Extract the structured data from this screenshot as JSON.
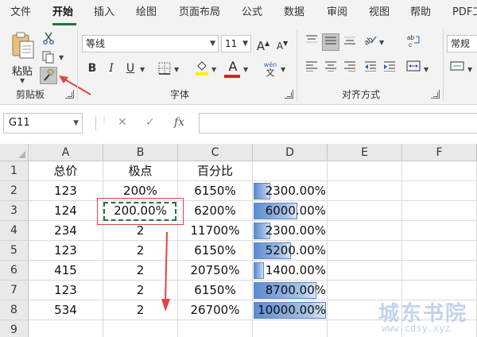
{
  "ribbon_tabs": [
    "文件",
    "开始",
    "插入",
    "绘图",
    "页面布局",
    "公式",
    "数据",
    "审阅",
    "视图",
    "帮助",
    "PDF工"
  ],
  "active_tab": "开始",
  "clipboard": {
    "paste_label": "粘贴",
    "group_label": "剪贴板"
  },
  "font": {
    "name": "等线",
    "size": "11",
    "group_label": "字体",
    "bold": "B",
    "italic": "I",
    "underline": "U",
    "increase": "A",
    "decrease": "A",
    "font_color_letter": "A",
    "phonetic": "wén",
    "phonetic_char": "文"
  },
  "alignment": {
    "group_label": "对齐方式"
  },
  "number": {
    "format": "常规"
  },
  "formula_bar": {
    "name_box": "G11",
    "fx": "fx",
    "value": ""
  },
  "grid": {
    "columns": [
      "A",
      "B",
      "C",
      "D",
      "E",
      "F"
    ],
    "rows": [
      "1",
      "2",
      "3",
      "4",
      "5",
      "6",
      "7",
      "8",
      "9"
    ],
    "data": [
      [
        "总价",
        "极点",
        "百分比",
        "",
        "",
        ""
      ],
      [
        "123",
        "200%",
        "6150%",
        "2300.00%",
        "",
        ""
      ],
      [
        "124",
        "200.00%",
        "6200%",
        "6000.00%",
        "",
        ""
      ],
      [
        "234",
        "2",
        "11700%",
        "2300.00%",
        "",
        ""
      ],
      [
        "123",
        "2",
        "6150%",
        "5200.00%",
        "",
        ""
      ],
      [
        "415",
        "2",
        "20750%",
        "1400.00%",
        "",
        ""
      ],
      [
        "123",
        "2",
        "6150%",
        "8700.00%",
        "",
        ""
      ],
      [
        "534",
        "2",
        "26700%",
        "10000.00%",
        "",
        ""
      ],
      [
        "",
        "",
        "",
        "",
        "",
        ""
      ]
    ],
    "databar_values": [
      23,
      60,
      23,
      52,
      14,
      87,
      100
    ],
    "databar_max": 100
  },
  "watermark": {
    "text": "城东书院",
    "url": "www.cdsy.xyz"
  },
  "colors": {
    "accent": "#217346",
    "annotation": "#e04444",
    "databar": "#5b8bd0"
  }
}
